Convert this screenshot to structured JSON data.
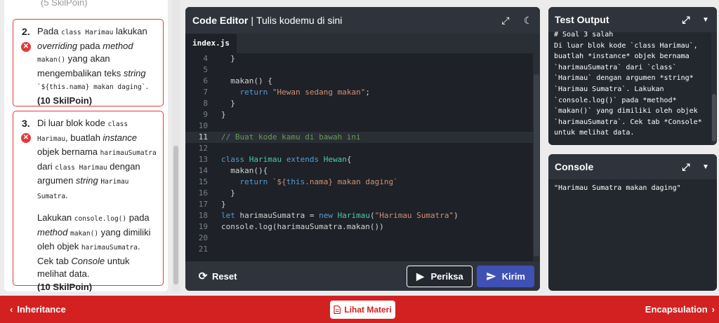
{
  "left": {
    "top_text": "(5 SkilPoin)",
    "task2": {
      "number": "2.",
      "p1": "Pada ",
      "c1": "class Harimau",
      "p2": " lakukan ",
      "e1": "overriding",
      "p3": " pada ",
      "e2": "method",
      "p4": " ",
      "c2": "makan()",
      "p5": " yang akan mengembalikan teks ",
      "e3": "string",
      "p6": " ",
      "c3": "`${this.nama} makan daging`",
      "p7": ".",
      "points": "(10 SkilPoin)"
    },
    "task3": {
      "number": "3.",
      "p1": "Di luar blok kode ",
      "c1": "class Harimau",
      "p2": ", buatlah ",
      "e1": "instance",
      "p3": " objek bernama ",
      "c2": "harimauSumatra",
      "p4": " dari ",
      "c3": "class Harimau",
      "p5": " dengan argumen ",
      "e2": "string",
      "p6": " ",
      "c4": "Harimau Sumatra",
      "p7": ".",
      "q1": "Lakukan ",
      "qc1": "console.log()",
      "q2": " pada ",
      "qe1": "method",
      "q3": " ",
      "qc2": "makan()",
      "q4": " yang dimiliki oleh objek ",
      "qc3": "harimauSumatra",
      "q5": ". Cek tab ",
      "qe2": "Console",
      "q6": " untuk melihat data.",
      "points": "(10 SkilPoin)"
    }
  },
  "editor": {
    "title": "Code Editor",
    "separator": "|",
    "subtitle": "Tulis kodemu di sini",
    "file_tab": "index.js",
    "lines": {
      "n4": "4",
      "n5": "5",
      "n6": "6",
      "n7": "7",
      "n8": "8",
      "n9": "9",
      "n10": "10",
      "n11": "11",
      "n12": "12",
      "n13": "13",
      "n14": "14",
      "n15": "15",
      "n16": "16",
      "n17": "17",
      "n18": "18",
      "n19": "19",
      "n20": "20",
      "n21": "21"
    },
    "code": {
      "l4": "  }",
      "l6a": "  makan() {",
      "l7a": "    ",
      "l7k": "return",
      "l7s": " \"Hewan sedang makan\"",
      "l7p": ";",
      "l8": "  }",
      "l9": "}",
      "l11": "// Buat kode kamu di bawah ini",
      "l13k1": "class",
      "l13t1": " Harimau",
      "l13k2": " extends",
      "l13t2": " Hewan",
      "l13p": "{",
      "l14": "  makan(){",
      "l15a": "    ",
      "l15k": "return",
      "l15s1": " `${",
      "l15k2": "this",
      "l15s2": ".nama} makan daging`",
      "l16": "  }",
      "l17": "}",
      "l18k": "let",
      "l18p1": " harimauSumatra = ",
      "l18k2": "new",
      "l18t": " Harimau",
      "l18p2": "(",
      "l18s": "\"Harimau Sumatra\"",
      "l18p3": ")",
      "l19": "console.log(harimauSumatra.makan())"
    },
    "reset_label": "Reset",
    "periksa_label": "Periksa",
    "kirim_label": "Kirim"
  },
  "test_output": {
    "title": "Test Output",
    "text": "# Soal 3 salah\nDi luar blok kode `class Harimau`, buatlah *instance* objek bernama `harimauSumatra` dari `class` `Harimau` dengan argumen *string* `Harimau Sumatra`. Lakukan `console.log()` pada *method* `makan()` yang dimiliki oleh objek `harimauSumatra`. Cek tab *Console* untuk melihat data."
  },
  "console": {
    "title": "Console",
    "text": "\"Harimau Sumatra makan daging\""
  },
  "nav": {
    "prev_label": "Inheritance",
    "next_label": "Encapsulation",
    "materi_label": "Lihat Materi"
  },
  "icons": {
    "error": "x-circle-icon",
    "expand": "expand-icon",
    "theme": "moon-icon",
    "chevron": "chevron-down-icon",
    "reset": "reset-icon",
    "play": "play-icon",
    "send": "send-icon",
    "doc": "document-icon"
  },
  "colors": {
    "accent_red": "#d32121",
    "button_blue": "#3f51b5",
    "editor_bg": "#1e2127"
  }
}
